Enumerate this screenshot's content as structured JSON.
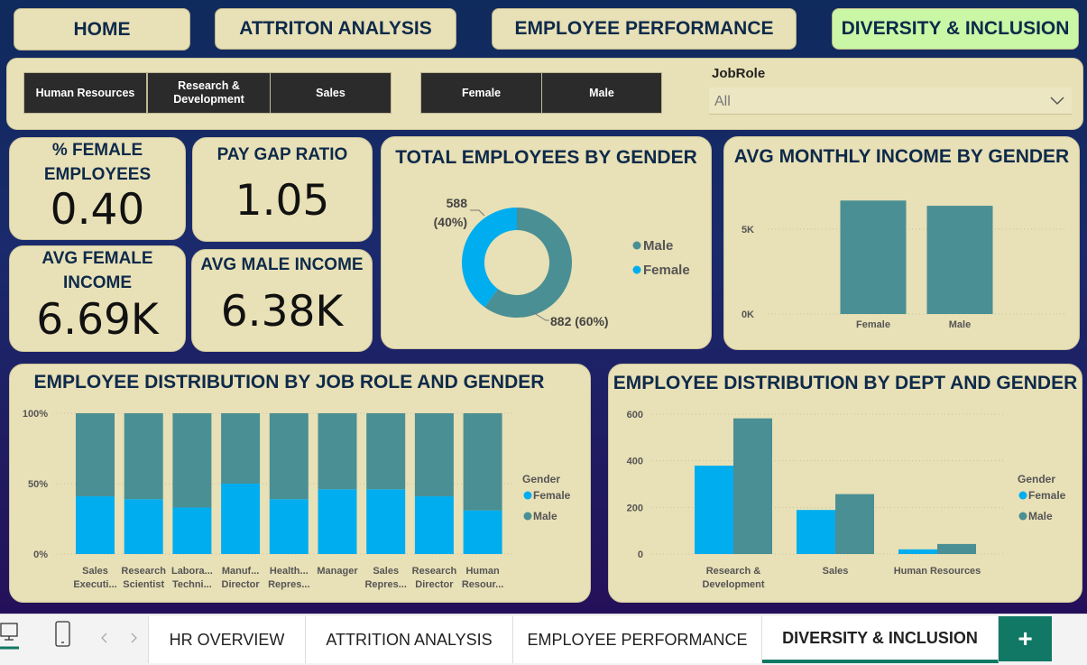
{
  "nav": {
    "home": "HOME",
    "attrition": "ATTRITON ANALYSIS",
    "performance": "EMPLOYEE PERFORMANCE",
    "diversity": "DIVERSITY & INCLUSION"
  },
  "slicers": {
    "departments": [
      "Human Resources",
      "Research & Development",
      "Sales"
    ],
    "genders": [
      "Female",
      "Male"
    ],
    "jobrole_label": "JobRole",
    "jobrole_value": "All"
  },
  "kpis": {
    "female_pct_title": "% FEMALE EMPLOYEES",
    "female_pct_value": "0.40",
    "pay_gap_title": "PAY GAP RATIO",
    "pay_gap_value": "1.05",
    "avg_female_title": "AVG FEMALE INCOME",
    "avg_female_value": "6.69K",
    "avg_male_title": "AVG MALE INCOME",
    "avg_male_value": "6.38K"
  },
  "colors": {
    "female": "#00adef",
    "male": "#4a8f94",
    "card": "#e8e0b6",
    "title": "#0e2a4a"
  },
  "chart_data": [
    {
      "type": "pie",
      "title": "TOTAL EMPLOYEES BY GENDER",
      "slices": [
        {
          "label": "Male",
          "value": 882,
          "data_label": "882 (60%)"
        },
        {
          "label": "Female",
          "value": 588,
          "data_label": "588 (40%)"
        }
      ],
      "legend": [
        "Male",
        "Female"
      ],
      "legend_position": "right"
    },
    {
      "type": "bar",
      "title": "AVG MONTHLY INCOME BY GENDER",
      "categories": [
        "Female",
        "Male"
      ],
      "values": [
        6690,
        6380
      ],
      "yticks": [
        "0K",
        "5K"
      ],
      "ylim": [
        0,
        8300
      ]
    },
    {
      "type": "bar",
      "stacked": true,
      "title": "EMPLOYEE DISTRIBUTION BY JOB ROLE AND GENDER",
      "categories": [
        [
          "Sales",
          "Executi..."
        ],
        [
          "Research",
          "Scientist"
        ],
        [
          "Labora...",
          "Techni..."
        ],
        [
          "Manuf...",
          "Director"
        ],
        [
          "Health...",
          "Repres..."
        ],
        [
          "Manager",
          ""
        ],
        [
          "Sales",
          "Repres..."
        ],
        [
          "Research",
          "Director"
        ],
        [
          "Human",
          "Resour..."
        ]
      ],
      "series": [
        {
          "name": "Female",
          "values": [
            0.41,
            0.39,
            0.33,
            0.5,
            0.39,
            0.46,
            0.46,
            0.41,
            0.31
          ]
        },
        {
          "name": "Male",
          "values": [
            0.59,
            0.61,
            0.67,
            0.5,
            0.61,
            0.54,
            0.54,
            0.59,
            0.69
          ]
        }
      ],
      "yticks": [
        "0%",
        "50%",
        "100%"
      ],
      "ylim": [
        0,
        1
      ],
      "legend_title": "Gender",
      "legend": [
        "Female",
        "Male"
      ],
      "legend_position": "right"
    },
    {
      "type": "bar",
      "title": "EMPLOYEE DISTRIBUTION BY DEPT AND GENDER",
      "categories": [
        [
          "Research &",
          "Development"
        ],
        [
          "Sales",
          ""
        ],
        [
          "Human Resources",
          ""
        ]
      ],
      "series": [
        {
          "name": "Female",
          "values": [
            379,
            189,
            20
          ]
        },
        {
          "name": "Male",
          "values": [
            582,
            257,
            43
          ]
        }
      ],
      "yticks": [
        "0",
        "200",
        "400",
        "600"
      ],
      "ylim": [
        0,
        600
      ],
      "legend_title": "Gender",
      "legend": [
        "Female",
        "Male"
      ],
      "legend_position": "right"
    }
  ],
  "tabs": [
    "HR OVERVIEW",
    "ATTRITION ANALYSIS",
    "EMPLOYEE PERFORMANCE",
    "DIVERSITY & INCLUSION"
  ],
  "tab_add": "+"
}
